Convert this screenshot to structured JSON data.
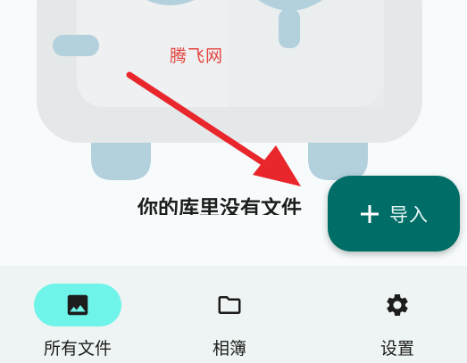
{
  "watermark": "腾飞网",
  "empty_state": {
    "message": "你的库里没有文件"
  },
  "fab": {
    "label": "导入",
    "icon": "plus-icon",
    "color": "#006e67"
  },
  "bottom_nav": {
    "active_color": "#6ff4ea",
    "items": [
      {
        "label": "所有文件",
        "icon": "image-icon",
        "active": true
      },
      {
        "label": "相簿",
        "icon": "folder-icon",
        "active": false
      },
      {
        "label": "设置",
        "icon": "gear-icon",
        "active": false
      }
    ]
  }
}
